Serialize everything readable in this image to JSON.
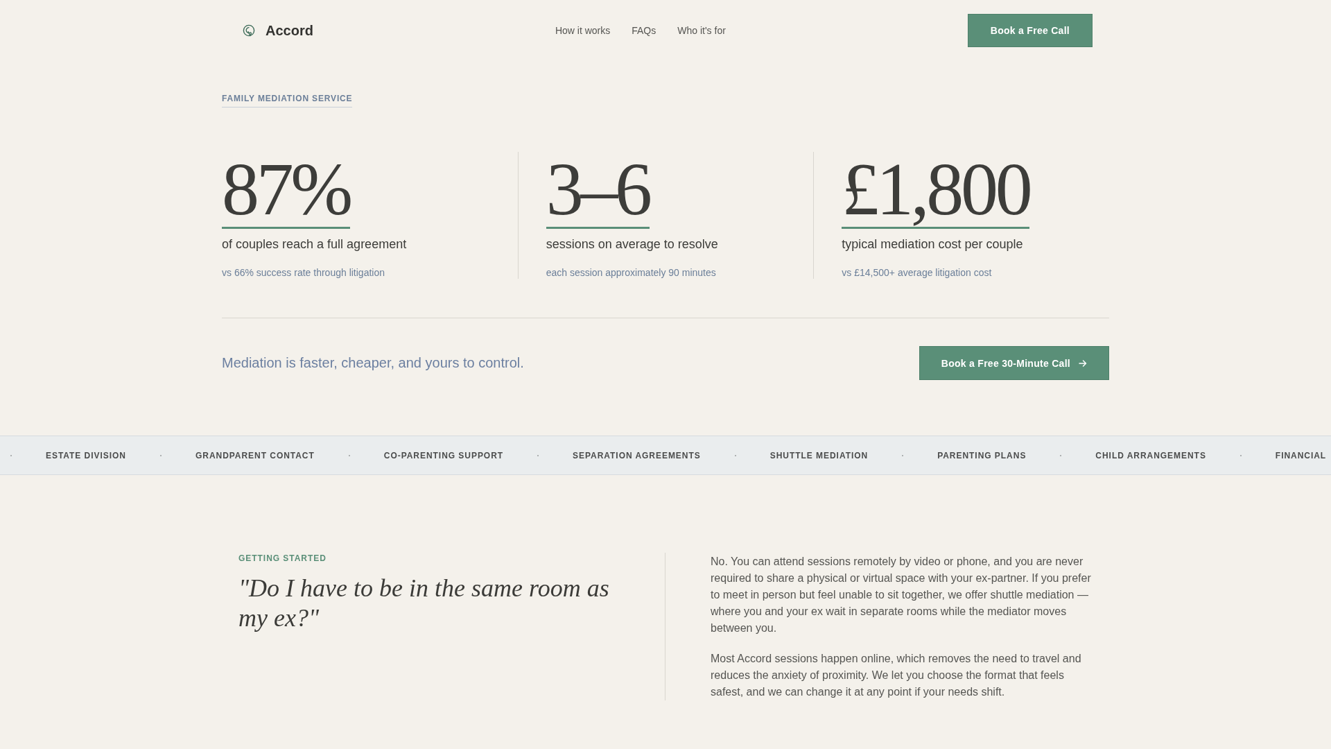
{
  "header": {
    "brand": "Accord",
    "nav": [
      "How it works",
      "FAQs",
      "Who it's for"
    ],
    "cta": "Book a Free Call"
  },
  "hero": {
    "eyebrow": "FAMILY MEDIATION SERVICE",
    "stats": [
      {
        "value": "87%",
        "label": "of couples reach a full agreement",
        "note": "vs 66% success rate through litigation"
      },
      {
        "value": "3–6",
        "label": "sessions on average to resolve",
        "note": "each session approximately 90 minutes"
      },
      {
        "value": "£1,800",
        "label": "typical mediation cost per couple",
        "note": "vs £14,500+ average litigation cost"
      }
    ],
    "tagline": "Mediation is faster, cheaper, and yours to control.",
    "cta": "Book a Free 30-Minute Call"
  },
  "ticker": [
    "ESTATE DIVISION",
    "GRANDPARENT CONTACT",
    "CO-PARENTING SUPPORT",
    "SEPARATION AGREEMENTS",
    "SHUTTLE MEDIATION",
    "PARENTING PLANS",
    "CHILD ARRANGEMENTS",
    "FINANCIAL"
  ],
  "faq": {
    "eyebrow": "GETTING STARTED",
    "question": "\"Do I have to be in the same room as my ex?\"",
    "answer": [
      "No. You can attend sessions remotely by video or phone, and you are never required to share a physical or virtual space with your ex-partner. If you prefer to meet in person but feel unable to sit together, we offer shuttle mediation — where you and your ex wait in separate rooms while the mediator moves between you.",
      "Most Accord sessions happen online, which removes the need to travel and reduces the anxiety of proximity. We let you choose the format that feels safest, and we can change it at any point if your needs shift."
    ]
  }
}
